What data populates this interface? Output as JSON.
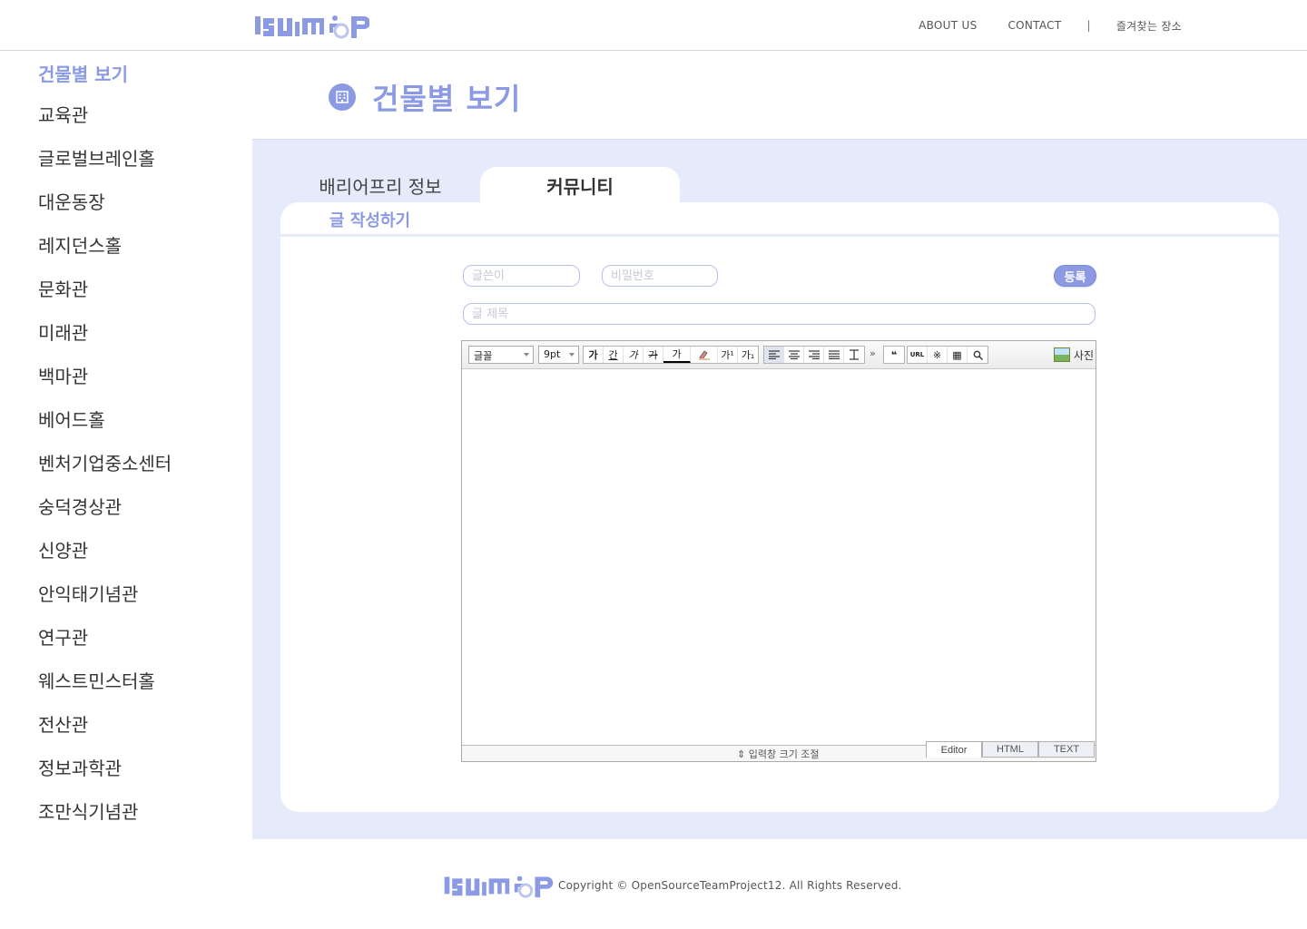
{
  "header": {
    "logo_text": "ssu map",
    "nav": {
      "about": "ABOUT US",
      "contact": "CONTACT",
      "separator": "|",
      "favorites": "즐겨찾는 장소"
    }
  },
  "sidebar": {
    "title": "건물별 보기",
    "items": [
      "교육관",
      "글로벌브레인홀",
      "대운동장",
      "레지던스홀",
      "문화관",
      "미래관",
      "백마관",
      "베어드홀",
      "벤처기업중소센터",
      "숭덕경상관",
      "신양관",
      "안익태기념관",
      "연구관",
      "웨스트민스터홀",
      "전산관",
      "정보과학관",
      "조만식기념관"
    ]
  },
  "page": {
    "title": "건물별 보기",
    "icon": "building-icon"
  },
  "tabs": {
    "barrier_free": "배리어프리 정보",
    "community": "커뮤니티"
  },
  "form": {
    "heading": "글 작성하기",
    "author_placeholder": "글쓴이",
    "password_placeholder": "비밀번호",
    "title_placeholder": "글 제목",
    "submit_label": "등록"
  },
  "editor": {
    "font_select": "글꼴",
    "size_select": "9pt",
    "photo_label": "사진",
    "resize_label": "⇕ 입력창 크기 조절",
    "modes": [
      "Editor",
      "HTML",
      "TEXT"
    ],
    "buttons": {
      "bold": "가",
      "underline": "간",
      "italic": "가",
      "strike": "가",
      "font_color": "가",
      "superscript": "가¹",
      "subscript": "가₁",
      "more": "»",
      "quote": "❝",
      "url": "URL",
      "special_char": "※",
      "table": "▦",
      "search": "🔍"
    }
  },
  "footer": {
    "copyright": "Copyright © OpenSourceTeamProject12. All Rights Reserved."
  },
  "colors": {
    "accent": "#8b9ae3",
    "panel_bg": "#e6ebfb",
    "card_bg": "#ffffff"
  }
}
